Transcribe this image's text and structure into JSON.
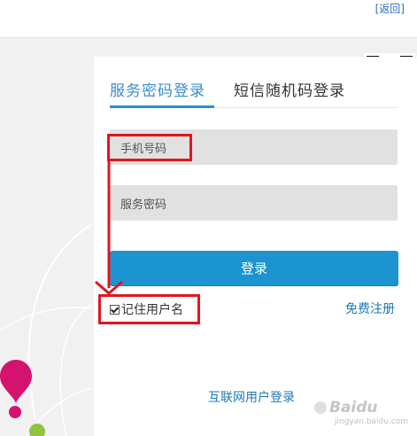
{
  "header": {
    "back_label": "[返回]"
  },
  "login": {
    "tabs": [
      {
        "label": "服务密码登录",
        "active": true
      },
      {
        "label": "短信随机码登录",
        "active": false
      }
    ],
    "phone_placeholder": "手机号码",
    "password_placeholder": "服务密码",
    "submit_label": "登录",
    "remember_label": "记住用户名",
    "remember_checked": true,
    "register_label": "免费注册",
    "internet_user_login_label": "互联网用户登录"
  },
  "watermark": {
    "brand": "Baidu",
    "sub": "jingyan.baidu.com"
  },
  "colors": {
    "accent": "#2b8fc9",
    "button": "#1b94cf",
    "link": "#1f78b4",
    "annotation": "#e0161f",
    "field_bg": "#e1e1e1"
  }
}
